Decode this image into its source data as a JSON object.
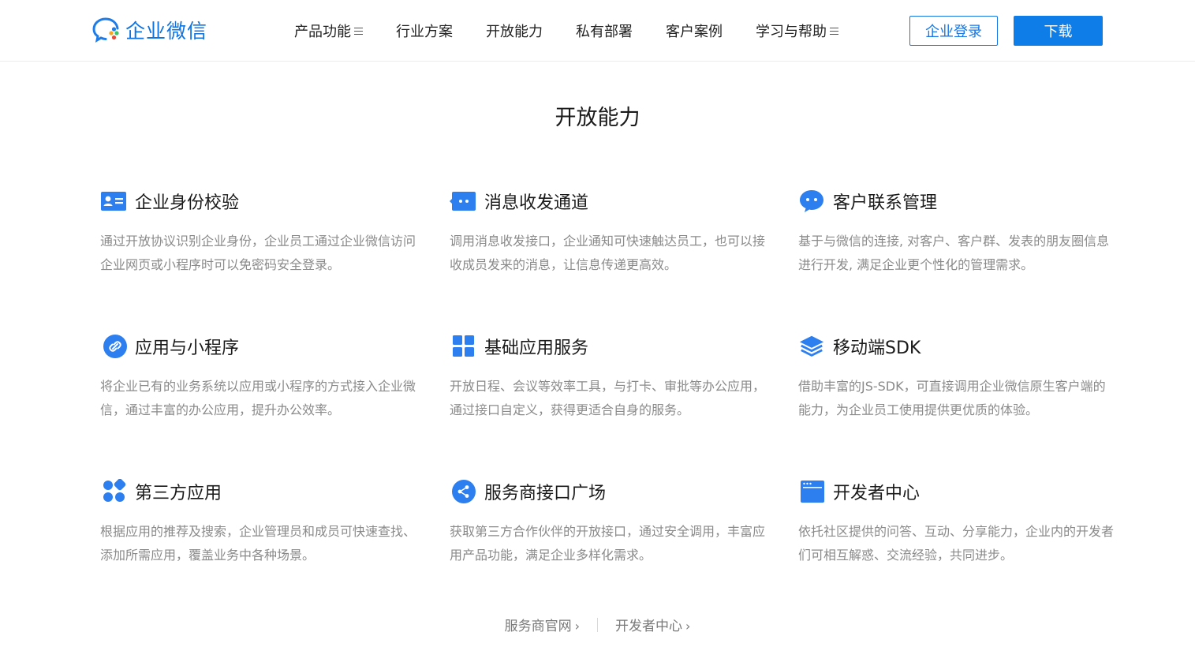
{
  "header": {
    "logo_text": "企业微信",
    "nav": [
      {
        "label": "产品功能",
        "has_menu": true
      },
      {
        "label": "行业方案",
        "has_menu": false
      },
      {
        "label": "开放能力",
        "has_menu": false
      },
      {
        "label": "私有部署",
        "has_menu": false
      },
      {
        "label": "客户案例",
        "has_menu": false
      },
      {
        "label": "学习与帮助",
        "has_menu": true
      }
    ],
    "login_label": "企业登录",
    "download_label": "下载"
  },
  "section_title": "开放能力",
  "cards": [
    {
      "icon": "id-card-icon",
      "title": "企业身份校验",
      "desc": "通过开放协议识别企业身份，企业员工通过企业微信访问企业网页或小程序时可以免密码安全登录。"
    },
    {
      "icon": "message-icon",
      "title": "消息收发通道",
      "desc": "调用消息收发接口，企业通知可快速触达员工，也可以接收成员发来的消息，让信息传递更高效。"
    },
    {
      "icon": "chat-bubble-icon",
      "title": "客户联系管理",
      "desc": "基于与微信的连接, 对客户、客户群、发表的朋友圈信息进行开发, 满足企业更个性化的管理需求。"
    },
    {
      "icon": "link-icon",
      "title": "应用与小程序",
      "desc": "将企业已有的业务系统以应用或小程序的方式接入企业微信，通过丰富的办公应用，提升办公效率。"
    },
    {
      "icon": "grid-icon",
      "title": "基础应用服务",
      "desc": "开放日程、会议等效率工具，与打卡、审批等办公应用，通过接口自定义，获得更适合自身的服务。"
    },
    {
      "icon": "layers-icon",
      "title": "移动端SDK",
      "desc": "借助丰富的JS-SDK，可直接调用企业微信原生客户端的能力，为企业员工使用提供更优质的体验。"
    },
    {
      "icon": "apps-dots-icon",
      "title": "第三方应用",
      "desc": "根据应用的推荐及搜索，企业管理员和成员可快速查找、添加所需应用，覆盖业务中各种场景。"
    },
    {
      "icon": "share-icon",
      "title": "服务商接口广场",
      "desc": "获取第三方合作伙伴的开放接口，通过安全调用，丰富应用产品功能，满足企业多样化需求。"
    },
    {
      "icon": "browser-window-icon",
      "title": "开发者中心",
      "desc": "依托社区提供的问答、互动、分享能力，企业内的开发者们可相互解惑、交流经验，共同进步。"
    }
  ],
  "footer_links": [
    {
      "label": "服务商官网",
      "arrow": "›"
    },
    {
      "label": "开发者中心",
      "arrow": "›"
    }
  ],
  "colors": {
    "brand_blue": "#0f74e3",
    "button_blue": "#0f7de8",
    "icon_blue": "#2d7ff0",
    "text_gray": "#8a8a8a"
  }
}
